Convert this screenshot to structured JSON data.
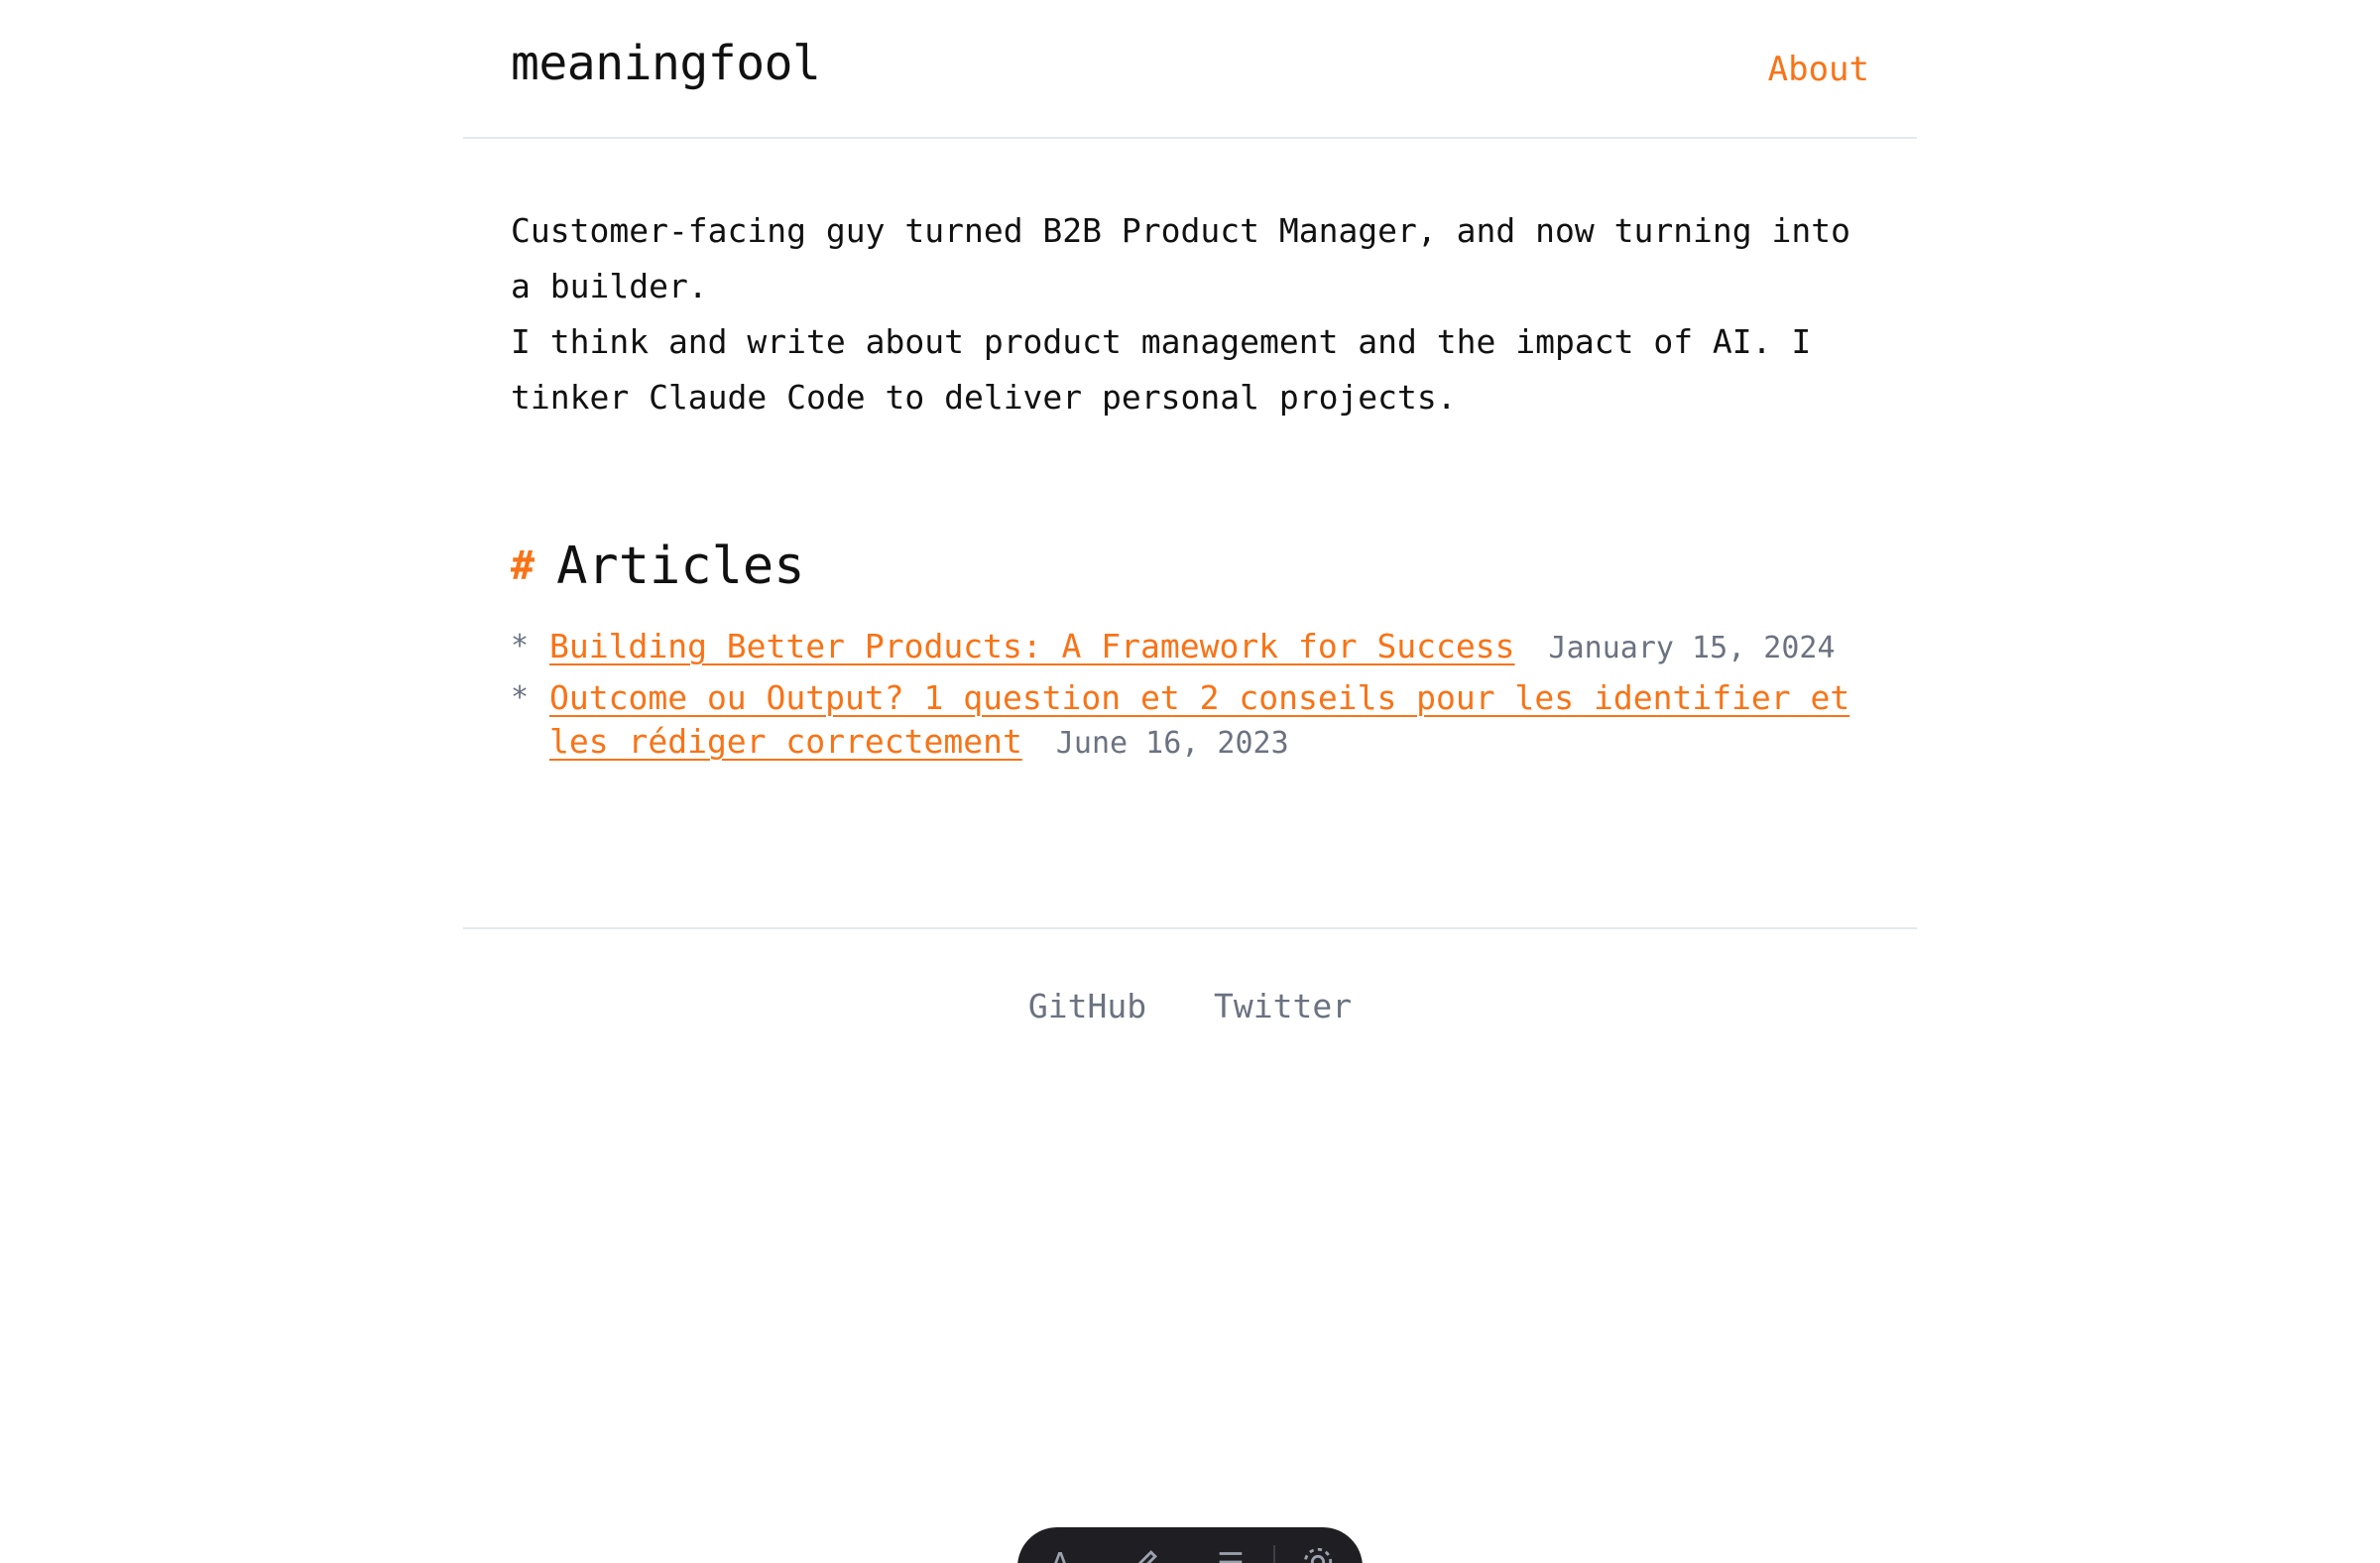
{
  "header": {
    "site_title": "meaningfool",
    "nav_about": "About"
  },
  "intro": {
    "line1": "Customer-facing guy turned B2B Product Manager, and now turning into a builder.",
    "line2": "I think and write about product management and the impact of AI. I tinker Claude Code to deliver personal projects."
  },
  "articles": {
    "heading_marker": "#",
    "heading": "Articles",
    "bullet": "*",
    "items": [
      {
        "title": "Building Better Products: A Framework for Success",
        "date": "January 15, 2024"
      },
      {
        "title": "Outcome ou Output? 1 question et 2 conseils pour les identifier et les rédiger correctement",
        "date": "June 16, 2023"
      }
    ]
  },
  "footer": {
    "links": [
      "GitHub",
      "Twitter"
    ]
  },
  "toolbar": {
    "icons": [
      "text-icon",
      "draw-icon",
      "list-icon",
      "gear-icon"
    ]
  },
  "colors": {
    "accent": "#f97316",
    "text": "#111111",
    "muted": "#6b7280",
    "divider": "#e5e7eb",
    "toolbar_bg": "#1f1f23"
  }
}
